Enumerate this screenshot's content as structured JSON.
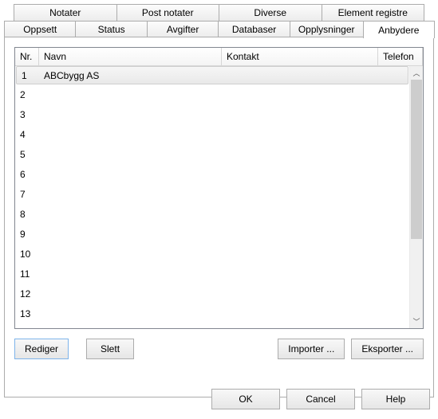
{
  "tabs": {
    "row1": [
      "Notater",
      "Post notater",
      "Diverse",
      "Element registre"
    ],
    "row2": [
      "Oppsett",
      "Status",
      "Avgifter",
      "Databaser",
      "Opplysninger",
      "Anbydere"
    ],
    "active": "Anbydere"
  },
  "table": {
    "headers": {
      "nr": "Nr.",
      "navn": "Navn",
      "kontakt": "Kontakt",
      "telefon": "Telefon"
    },
    "rows": [
      {
        "nr": "1",
        "navn": "ABCbygg AS",
        "kontakt": "",
        "telefon": "",
        "selected": true
      },
      {
        "nr": "2",
        "navn": "",
        "kontakt": "",
        "telefon": ""
      },
      {
        "nr": "3",
        "navn": "",
        "kontakt": "",
        "telefon": ""
      },
      {
        "nr": "4",
        "navn": "",
        "kontakt": "",
        "telefon": ""
      },
      {
        "nr": "5",
        "navn": "",
        "kontakt": "",
        "telefon": ""
      },
      {
        "nr": "6",
        "navn": "",
        "kontakt": "",
        "telefon": ""
      },
      {
        "nr": "7",
        "navn": "",
        "kontakt": "",
        "telefon": ""
      },
      {
        "nr": "8",
        "navn": "",
        "kontakt": "",
        "telefon": ""
      },
      {
        "nr": "9",
        "navn": "",
        "kontakt": "",
        "telefon": ""
      },
      {
        "nr": "10",
        "navn": "",
        "kontakt": "",
        "telefon": ""
      },
      {
        "nr": "11",
        "navn": "",
        "kontakt": "",
        "telefon": ""
      },
      {
        "nr": "12",
        "navn": "",
        "kontakt": "",
        "telefon": ""
      },
      {
        "nr": "13",
        "navn": "",
        "kontakt": "",
        "telefon": ""
      }
    ]
  },
  "buttons": {
    "rediger": "Rediger",
    "slett": "Slett",
    "importer": "Importer ...",
    "eksporter": "Eksporter ..."
  },
  "footer": {
    "ok": "OK",
    "cancel": "Cancel",
    "help": "Help"
  }
}
